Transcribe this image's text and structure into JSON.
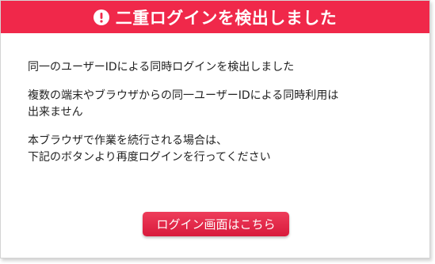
{
  "header": {
    "icon": "exclamation-circle-icon",
    "title": "二重ログインを検出しました"
  },
  "message": {
    "line1": "同一のユーザーIDによる同時ログインを検出しました",
    "line2a": "複数の端末やブラウザからの同一ユーザーIDによる同時利用は",
    "line2b": "出来ません",
    "line3a": "本ブラウザで作業を続行される場合は、",
    "line3b": "下記のボタンより再度ログインを行ってください"
  },
  "actions": {
    "login_label": "ログイン画面はこちら"
  },
  "colors": {
    "accent": "#f0284a",
    "button": "#d81a3c",
    "text": "#222222"
  }
}
